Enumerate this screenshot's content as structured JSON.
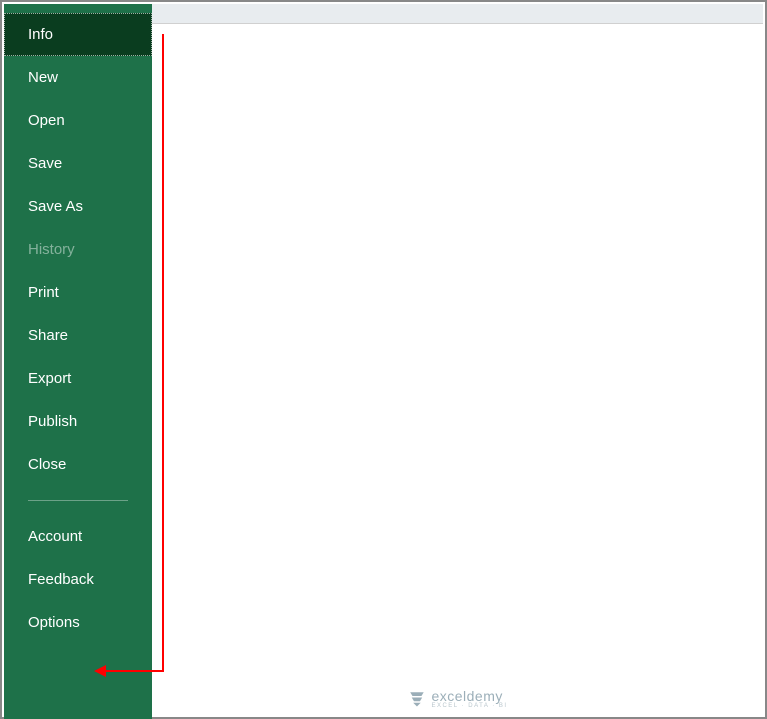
{
  "sidebar": {
    "items": [
      {
        "label": "Info",
        "selected": true,
        "disabled": false
      },
      {
        "label": "New",
        "selected": false,
        "disabled": false
      },
      {
        "label": "Open",
        "selected": false,
        "disabled": false
      },
      {
        "label": "Save",
        "selected": false,
        "disabled": false
      },
      {
        "label": "Save As",
        "selected": false,
        "disabled": false
      },
      {
        "label": "History",
        "selected": false,
        "disabled": true
      },
      {
        "label": "Print",
        "selected": false,
        "disabled": false
      },
      {
        "label": "Share",
        "selected": false,
        "disabled": false
      },
      {
        "label": "Export",
        "selected": false,
        "disabled": false
      },
      {
        "label": "Publish",
        "selected": false,
        "disabled": false
      },
      {
        "label": "Close",
        "selected": false,
        "disabled": false
      }
    ],
    "bottom_items": [
      {
        "label": "Account"
      },
      {
        "label": "Feedback"
      },
      {
        "label": "Options"
      }
    ]
  },
  "colors": {
    "sidebar_bg": "#1e7149",
    "sidebar_selected_bg": "#0a3d1f",
    "annotation_red": "#ff0000"
  },
  "branding": {
    "name": "exceldemy",
    "tagline": "EXCEL · DATA · BI"
  }
}
